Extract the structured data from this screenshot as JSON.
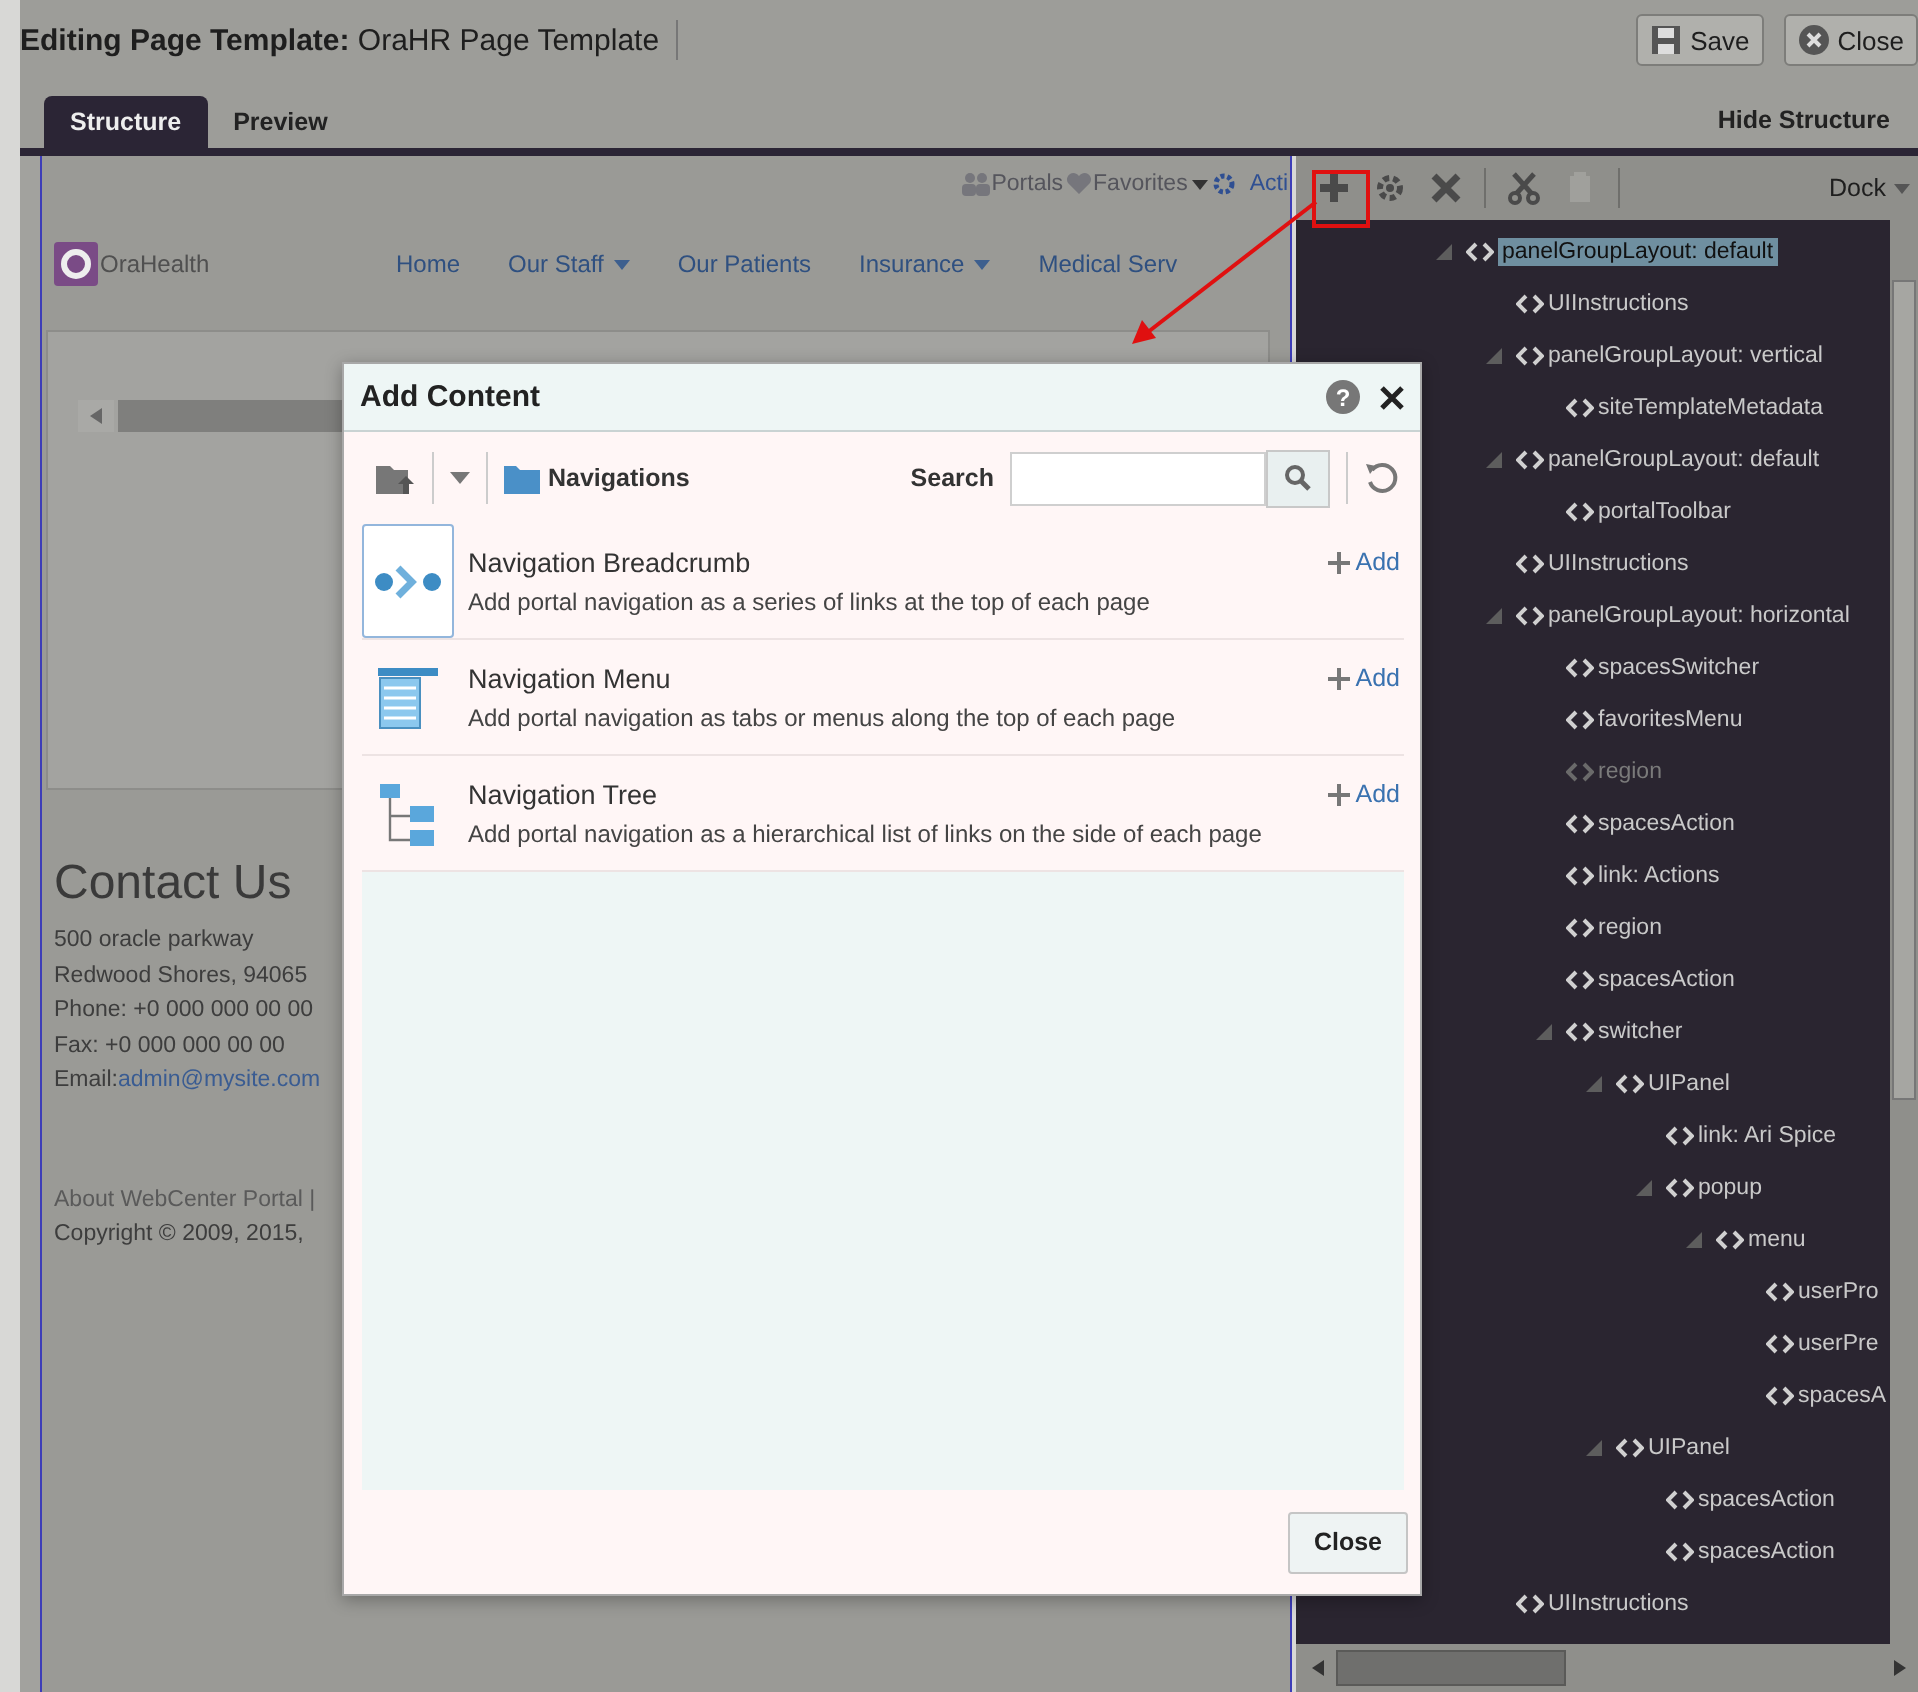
{
  "header": {
    "title_label": "Editing Page Template:",
    "title_value": "OraHR Page Template",
    "buttons": [
      {
        "label": "Save",
        "kind": "save"
      },
      {
        "label": "Close",
        "kind": "close"
      }
    ]
  },
  "tabs": [
    {
      "label": "Structure",
      "selected": true
    },
    {
      "label": "Preview",
      "selected": false
    }
  ],
  "hide_structure": "Hide Structure",
  "preview": {
    "top_links": [
      {
        "label": "Portals",
        "kind": "portals"
      },
      {
        "label": "Favorites",
        "kind": "favorites"
      },
      {
        "label": "Acti",
        "kind": "actions"
      }
    ],
    "logo": "OraHealth",
    "nav": [
      {
        "label": "Home",
        "dropdown": false
      },
      {
        "label": "Our Staff",
        "dropdown": true
      },
      {
        "label": "Our Patients",
        "dropdown": false
      },
      {
        "label": "Insurance",
        "dropdown": true
      },
      {
        "label": "Medical Serv",
        "dropdown": false
      }
    ],
    "contact": {
      "heading": "Contact Us",
      "lines": [
        "500 oracle parkway",
        "Redwood Shores, 94065",
        "Phone: +0 000 000 00 00",
        "Fax: +0 000 000 00 00"
      ],
      "email_label": "Email:",
      "email": "admin@mysite.com"
    },
    "footer": {
      "link": "About WebCenter Portal |",
      "copyright": "Copyright © 2009, 2015,"
    }
  },
  "structure_panel": {
    "toolbar": [
      {
        "kind": "add",
        "disabled": false
      },
      {
        "kind": "properties",
        "disabled": false
      },
      {
        "kind": "delete",
        "disabled": false
      },
      {
        "kind": "cut",
        "disabled": false
      },
      {
        "kind": "paste",
        "disabled": true
      }
    ],
    "dock": "Dock",
    "tree": [
      {
        "label": "panelGroupLayout: default",
        "selected": true,
        "disabled": false,
        "expanded": true,
        "children": [
          {
            "label": "UIInstructions",
            "selected": false,
            "disabled": false
          },
          {
            "label": "panelGroupLayout: vertical",
            "selected": false,
            "disabled": false,
            "expanded": true,
            "children": [
              {
                "label": "siteTemplateMetadata",
                "selected": false,
                "disabled": false
              }
            ]
          },
          {
            "label": "panelGroupLayout: default",
            "selected": false,
            "disabled": false,
            "expanded": true,
            "children": [
              {
                "label": "portalToolbar",
                "selected": false,
                "disabled": false
              }
            ]
          },
          {
            "label": "UIInstructions",
            "selected": false,
            "disabled": false
          },
          {
            "label": "panelGroupLayout: horizontal",
            "selected": false,
            "disabled": false,
            "expanded": true,
            "children": [
              {
                "label": "spacesSwitcher",
                "selected": false,
                "disabled": false
              },
              {
                "label": "favoritesMenu",
                "selected": false,
                "disabled": false
              },
              {
                "label": "region",
                "selected": false,
                "disabled": true
              },
              {
                "label": "spacesAction",
                "selected": false,
                "disabled": false
              },
              {
                "label": "link: Actions",
                "selected": false,
                "disabled": false
              },
              {
                "label": "region",
                "selected": false,
                "disabled": false
              },
              {
                "label": "spacesAction",
                "selected": false,
                "disabled": false
              },
              {
                "label": "switcher",
                "selected": false,
                "disabled": false,
                "expanded": true,
                "children": [
                  {
                    "label": "UIPanel",
                    "selected": false,
                    "disabled": false,
                    "expanded": true,
                    "children": [
                      {
                        "label": "link: Ari Spice",
                        "selected": false,
                        "disabled": false
                      },
                      {
                        "label": "popup",
                        "selected": false,
                        "disabled": false,
                        "expanded": true,
                        "children": [
                          {
                            "label": "menu",
                            "selected": false,
                            "disabled": false,
                            "expanded": true,
                            "children": [
                              {
                                "label": "userPro",
                                "selected": false,
                                "disabled": false
                              },
                              {
                                "label": "userPre",
                                "selected": false,
                                "disabled": false
                              },
                              {
                                "label": "spacesA",
                                "selected": false,
                                "disabled": false
                              }
                            ]
                          }
                        ]
                      }
                    ]
                  },
                  {
                    "label": "UIPanel",
                    "selected": false,
                    "disabled": false,
                    "expanded": true,
                    "children": [
                      {
                        "label": "spacesAction",
                        "selected": false,
                        "disabled": false
                      },
                      {
                        "label": "spacesAction",
                        "selected": false,
                        "disabled": false
                      }
                    ]
                  }
                ]
              }
            ]
          },
          {
            "label": "UIInstructions",
            "selected": false,
            "disabled": false
          }
        ]
      }
    ]
  },
  "dialog": {
    "title": "Add Content",
    "help": "?",
    "location": "Navigations",
    "search": {
      "label": "Search"
    },
    "items": [
      {
        "kind": "breadcrumb",
        "title": "Navigation Breadcrumb",
        "description": "Add portal navigation as a series of links at the top of each page",
        "add": "Add",
        "selected": true
      },
      {
        "kind": "menu",
        "title": "Navigation Menu",
        "description": "Add portal navigation as tabs or menus along the top of each page",
        "add": "Add",
        "selected": false
      },
      {
        "kind": "tree",
        "title": "Navigation Tree",
        "description": "Add portal navigation as a hierarchical list of links on the side of each page",
        "add": "Add",
        "selected": false
      }
    ],
    "close": "Close"
  }
}
